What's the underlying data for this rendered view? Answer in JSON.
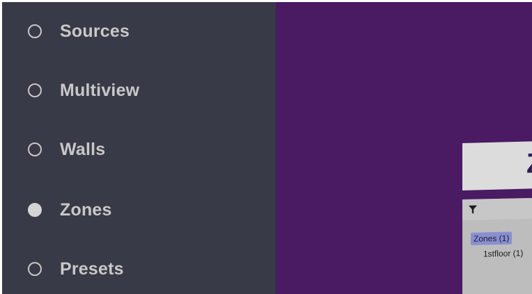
{
  "sidebar": {
    "items": [
      {
        "label": "Sources",
        "selected": false
      },
      {
        "label": "Multiview",
        "selected": false
      },
      {
        "label": "Walls",
        "selected": false
      },
      {
        "label": "Zones",
        "selected": true
      },
      {
        "label": "Presets",
        "selected": false
      }
    ]
  },
  "main": {
    "title_fragment": "Z",
    "tree": {
      "root_label": "Zones (1)",
      "child_label": "1stfloor (1)"
    }
  },
  "colors": {
    "sidebar_bg": "#393a47",
    "main_bg": "#4a1a63",
    "selection_highlight": "#8a8fd1"
  },
  "icons": {
    "radio_unchecked": "radio-unchecked-icon",
    "radio_checked": "radio-checked-icon",
    "filter": "filter-icon"
  }
}
